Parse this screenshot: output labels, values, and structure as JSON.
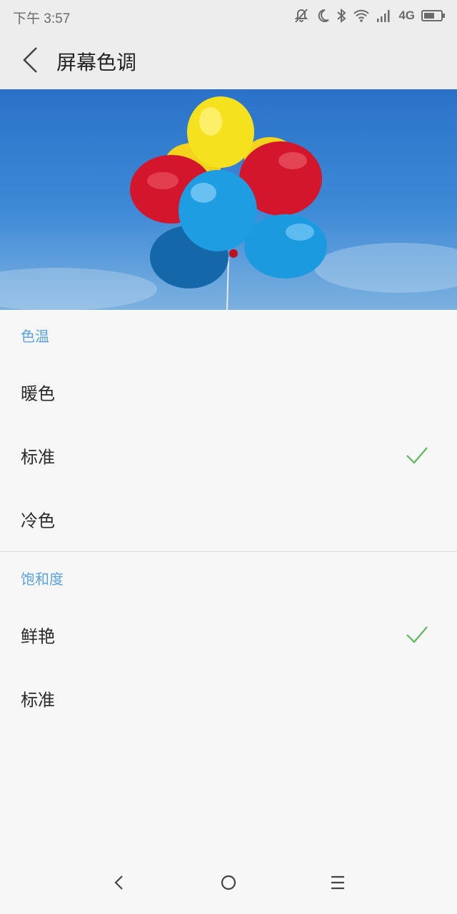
{
  "status_bar": {
    "time": "下午 3:57",
    "network": "4G",
    "icons": [
      "muted-bell-icon",
      "moon-icon",
      "bluetooth-icon",
      "wifi-icon",
      "signal-icon",
      "battery-icon"
    ]
  },
  "header": {
    "title": "屏幕色调",
    "back_icon": "chevron-left-icon"
  },
  "hero": {
    "description": "colorful balloons against blue sky"
  },
  "sections": {
    "color_temperature": {
      "title": "色温",
      "options": [
        {
          "label": "暖色",
          "selected": false
        },
        {
          "label": "标准",
          "selected": true
        },
        {
          "label": "冷色",
          "selected": false
        }
      ]
    },
    "saturation": {
      "title": "饱和度",
      "options": [
        {
          "label": "鲜艳",
          "selected": true
        },
        {
          "label": "标准",
          "selected": false
        }
      ]
    }
  },
  "nav_bar": {
    "buttons": [
      "back-nav-icon",
      "home-nav-icon",
      "menu-nav-icon"
    ]
  },
  "colors": {
    "accent": "#5aa3e0",
    "check": "#5cb85c"
  }
}
